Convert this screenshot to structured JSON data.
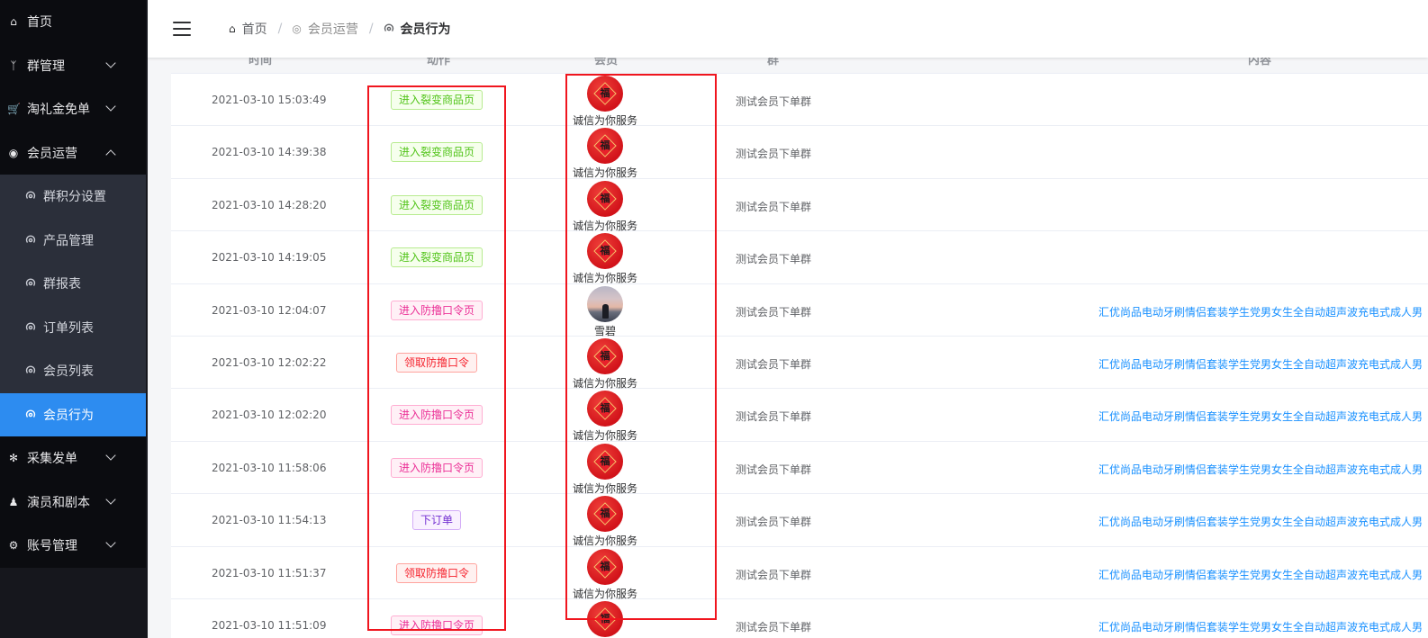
{
  "sidebar": {
    "items": [
      {
        "label": "首页",
        "icon": "home-icon"
      },
      {
        "label": "群管理",
        "icon": "branch-icon"
      },
      {
        "label": "淘礼金免单",
        "icon": "cart-icon"
      },
      {
        "label": "会员运营",
        "icon": "target-icon"
      }
    ],
    "subitems": [
      {
        "label": "群积分设置"
      },
      {
        "label": "产品管理"
      },
      {
        "label": "群报表"
      },
      {
        "label": "订单列表"
      },
      {
        "label": "会员列表"
      },
      {
        "label": "会员行为"
      }
    ],
    "items_after": [
      {
        "label": "采集发单",
        "icon": "bug-icon"
      },
      {
        "label": "演员和剧本",
        "icon": "users-icon"
      },
      {
        "label": "账号管理",
        "icon": "gear-icon"
      }
    ],
    "active_sub": "会员行为"
  },
  "breadcrumb": {
    "home": "首页",
    "parent": "会员运营",
    "current": "会员行为"
  },
  "table": {
    "headers": {
      "time": "时间",
      "action": "动作",
      "member": "会员",
      "group": "群",
      "content": "内容"
    },
    "rows": [
      {
        "time": "2021-03-10 15:03:49",
        "action": "进入裂变商品页",
        "tag": "green",
        "avatar": "fu",
        "nick": "诚信为你服务",
        "group": "测试会员下单群",
        "content": ""
      },
      {
        "time": "2021-03-10 14:39:38",
        "action": "进入裂变商品页",
        "tag": "green",
        "avatar": "fu",
        "nick": "诚信为你服务",
        "group": "测试会员下单群",
        "content": ""
      },
      {
        "time": "2021-03-10 14:28:20",
        "action": "进入裂变商品页",
        "tag": "green",
        "avatar": "fu",
        "nick": "诚信为你服务",
        "group": "测试会员下单群",
        "content": ""
      },
      {
        "time": "2021-03-10 14:19:05",
        "action": "进入裂变商品页",
        "tag": "green",
        "avatar": "fu",
        "nick": "诚信为你服务",
        "group": "测试会员下单群",
        "content": ""
      },
      {
        "time": "2021-03-10 12:04:07",
        "action": "进入防撸口令页",
        "tag": "pink",
        "avatar": "photo",
        "nick": "雪碧",
        "group": "测试会员下单群",
        "content": "汇优尚品电动牙刷情侣套装学生党男女生全自动超声波充电式成人男"
      },
      {
        "time": "2021-03-10 12:02:22",
        "action": "领取防撸口令",
        "tag": "red",
        "avatar": "fu",
        "nick": "诚信为你服务",
        "group": "测试会员下单群",
        "content": "汇优尚品电动牙刷情侣套装学生党男女生全自动超声波充电式成人男"
      },
      {
        "time": "2021-03-10 12:02:20",
        "action": "进入防撸口令页",
        "tag": "pink",
        "avatar": "fu",
        "nick": "诚信为你服务",
        "group": "测试会员下单群",
        "content": "汇优尚品电动牙刷情侣套装学生党男女生全自动超声波充电式成人男"
      },
      {
        "time": "2021-03-10 11:58:06",
        "action": "进入防撸口令页",
        "tag": "pink",
        "avatar": "fu",
        "nick": "诚信为你服务",
        "group": "测试会员下单群",
        "content": "汇优尚品电动牙刷情侣套装学生党男女生全自动超声波充电式成人男"
      },
      {
        "time": "2021-03-10 11:54:13",
        "action": "下订单",
        "tag": "purple",
        "avatar": "fu",
        "nick": "诚信为你服务",
        "group": "测试会员下单群",
        "content": "汇优尚品电动牙刷情侣套装学生党男女生全自动超声波充电式成人男"
      },
      {
        "time": "2021-03-10 11:51:37",
        "action": "领取防撸口令",
        "tag": "red",
        "avatar": "fu",
        "nick": "诚信为你服务",
        "group": "测试会员下单群",
        "content": "汇优尚品电动牙刷情侣套装学生党男女生全自动超声波充电式成人男"
      },
      {
        "time": "2021-03-10 11:51:09",
        "action": "进入防撸口令页",
        "tag": "pink",
        "avatar": "fu",
        "nick": "",
        "group": "测试会员下单群",
        "content": "汇优尚品电动牙刷情侣套装学生党男女生全自动超声波充电式成人男"
      }
    ]
  },
  "fu_char": "福",
  "colors": {
    "sidebar_bg": "#0b0c10",
    "submenu_bg": "#2b2f3a",
    "active_bg": "#2d8cf0",
    "highlight_box": "#f0151e",
    "link": "#1890ff"
  }
}
